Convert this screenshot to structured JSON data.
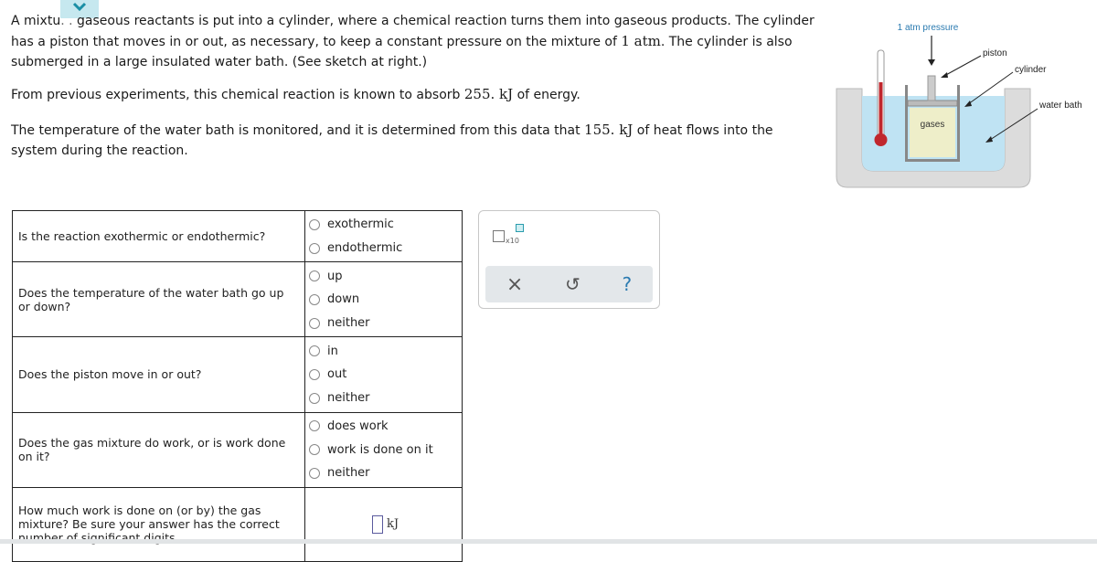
{
  "problem": {
    "intro_part1": "A mixtu",
    "intro_hidden": ". .",
    "intro_part2": " gaseous reactants is put into a cylinder, where a chemical reaction turns them into gaseous products. The cylinder has a piston that moves in or out, as necessary, to keep a constant pressure on the mixture of ",
    "pressure_value": "1 atm",
    "intro_part3": ". The cylinder is also submerged in a large insulated water bath. (See sketch at right.)",
    "energy_pre": "From previous experiments, this chemical reaction is known to absorb ",
    "energy_value": "255. kJ",
    "energy_post": " of energy.",
    "heat_pre": "The temperature of the water bath is monitored, and it is determined from this data that ",
    "heat_value": "155. kJ",
    "heat_post": " of heat flows into the system during the reaction."
  },
  "figure": {
    "pressure_label": "1 atm pressure",
    "piston_label": "piston",
    "cylinder_label": "cylinder",
    "water_bath_label": "water bath",
    "gases_label": "gases"
  },
  "questions": [
    {
      "text": "Is the reaction exothermic or endothermic?",
      "options": [
        "exothermic",
        "endothermic"
      ]
    },
    {
      "text": "Does the temperature of the water bath go up or down?",
      "options": [
        "up",
        "down",
        "neither"
      ]
    },
    {
      "text": "Does the piston move in or out?",
      "options": [
        "in",
        "out",
        "neither"
      ]
    },
    {
      "text": "Does the gas mixture do work, or is work done on it?",
      "options": [
        "does work",
        "work is done on it",
        "neither"
      ]
    },
    {
      "text": "How much work is done on (or by) the gas mixture? Be sure your answer has the correct number of significant digits.",
      "answer_value": "",
      "unit": "kJ"
    }
  ],
  "tools": {
    "sci_notation_label": "x10",
    "clear_icon": "×",
    "undo_icon": "↺",
    "help_icon": "?"
  },
  "colors": {
    "accent": "#2a9cad",
    "collapse_tab": "#c6e8ef",
    "water": "#bfe3f3",
    "thermometer": "#c0272d"
  }
}
